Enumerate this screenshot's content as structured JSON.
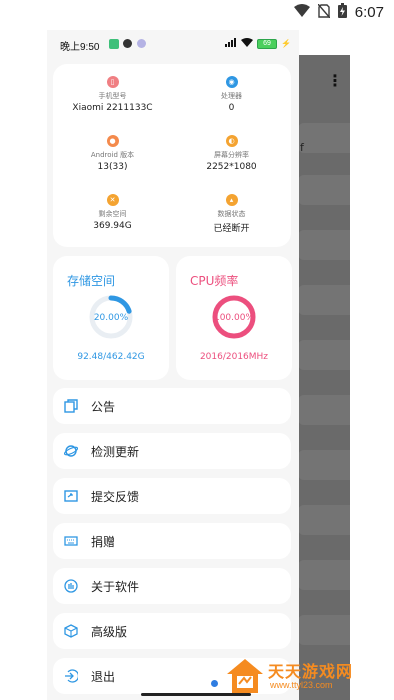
{
  "system_status": {
    "time": "6:07",
    "icons": [
      "wifi-icon",
      "no-sim-icon",
      "battery-charging-icon"
    ]
  },
  "inner_status": {
    "time": "晚上9:50",
    "battery": "69"
  },
  "device_info": [
    {
      "label": "手机型号",
      "value": "Xiaomi 2211133C",
      "icon": "phone-icon",
      "color": "#f07f83"
    },
    {
      "label": "处理器",
      "value": "0",
      "icon": "cpu-icon",
      "color": "#2f97e3"
    },
    {
      "label": "Android 版本",
      "value": "13(33)",
      "icon": "android-icon",
      "color": "#f48a4c"
    },
    {
      "label": "屏幕分辨率",
      "value": "2252*1080",
      "icon": "screen-icon",
      "color": "#f4a331"
    },
    {
      "label": "剩余空间",
      "value": "369.94G",
      "icon": "storage-icon",
      "color": "#f4a331"
    },
    {
      "label": "数据状态",
      "value": "已经断开",
      "icon": "data-icon",
      "color": "#f4a331"
    }
  ],
  "storage_card": {
    "title": "存储空间",
    "percent_text": "20.00%",
    "percent": 0.2,
    "footer": "92.48/462.42G",
    "color": "#2f97e3"
  },
  "cpu_card": {
    "title": "CPU频率",
    "percent_text": "100.00%",
    "percent": 1.0,
    "footer": "2016/2016MHz",
    "color": "#ec4f7e"
  },
  "menu": [
    {
      "label": "公告",
      "icon": "announcement-icon"
    },
    {
      "label": "检测更新",
      "icon": "update-icon"
    },
    {
      "label": "提交反馈",
      "icon": "feedback-icon"
    },
    {
      "label": "捐赠",
      "icon": "donate-icon"
    },
    {
      "label": "关于软件",
      "icon": "about-icon"
    },
    {
      "label": "高级版",
      "icon": "premium-icon"
    },
    {
      "label": "退出",
      "icon": "exit-icon"
    }
  ],
  "background_app": {
    "partial_text": "f"
  },
  "watermark": {
    "title": "天天游戏网",
    "url": "www.ttyl23.com"
  }
}
